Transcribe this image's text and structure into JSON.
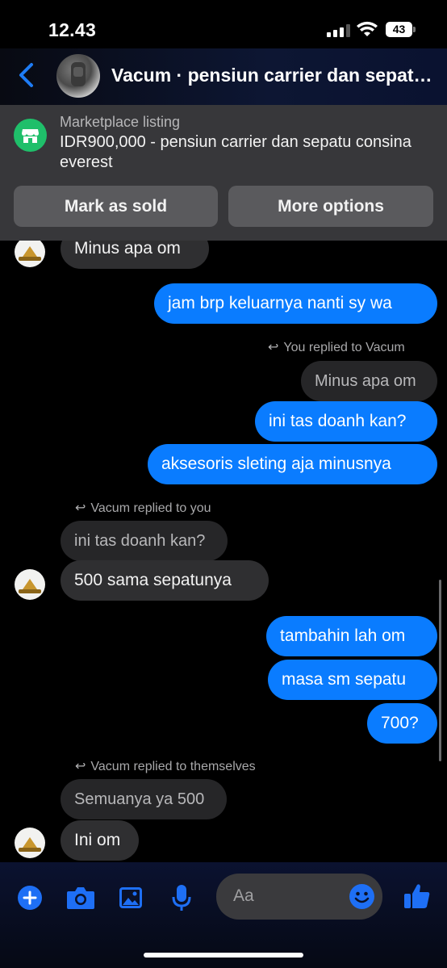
{
  "status_bar": {
    "time": "12.43",
    "battery": "43"
  },
  "header": {
    "title": "Vacum · pensiun carrier dan sepatu consina everest"
  },
  "marketplace": {
    "caption": "Marketplace listing",
    "listing_text": "IDR900,000 - pensiun carrier dan sepatu consina everest",
    "mark_sold_label": "Mark as sold",
    "more_options_label": "More options"
  },
  "messages": {
    "m1": "Minus apa om",
    "m2": "jam brp keluarnya nanti sy wa",
    "reply1": "You replied to Vacum",
    "q1": "Minus apa om",
    "m3": "ini tas doanh kan?",
    "m4": "aksesoris sleting aja minusnya",
    "reply2": "Vacum replied to you",
    "q2": "ini tas doanh kan?",
    "m5": "500 sama sepatunya",
    "m6": "tambahin lah om",
    "m7": "masa sm sepatu",
    "m8": "700?",
    "reply3": "Vacum replied to themselves",
    "q3": "Semuanya ya 500",
    "m9": "Ini om"
  },
  "composer": {
    "placeholder": "Aa"
  },
  "colors": {
    "accent": "#0a7cff",
    "incoming": "#2f2f31",
    "panel": "#37373a",
    "marketplace_icon": "#1fbf6a"
  },
  "icons": [
    "back-chevron-icon",
    "storefront-icon",
    "plus-icon",
    "camera-icon",
    "gallery-icon",
    "microphone-icon",
    "emoji-icon",
    "thumbs-up-icon"
  ]
}
